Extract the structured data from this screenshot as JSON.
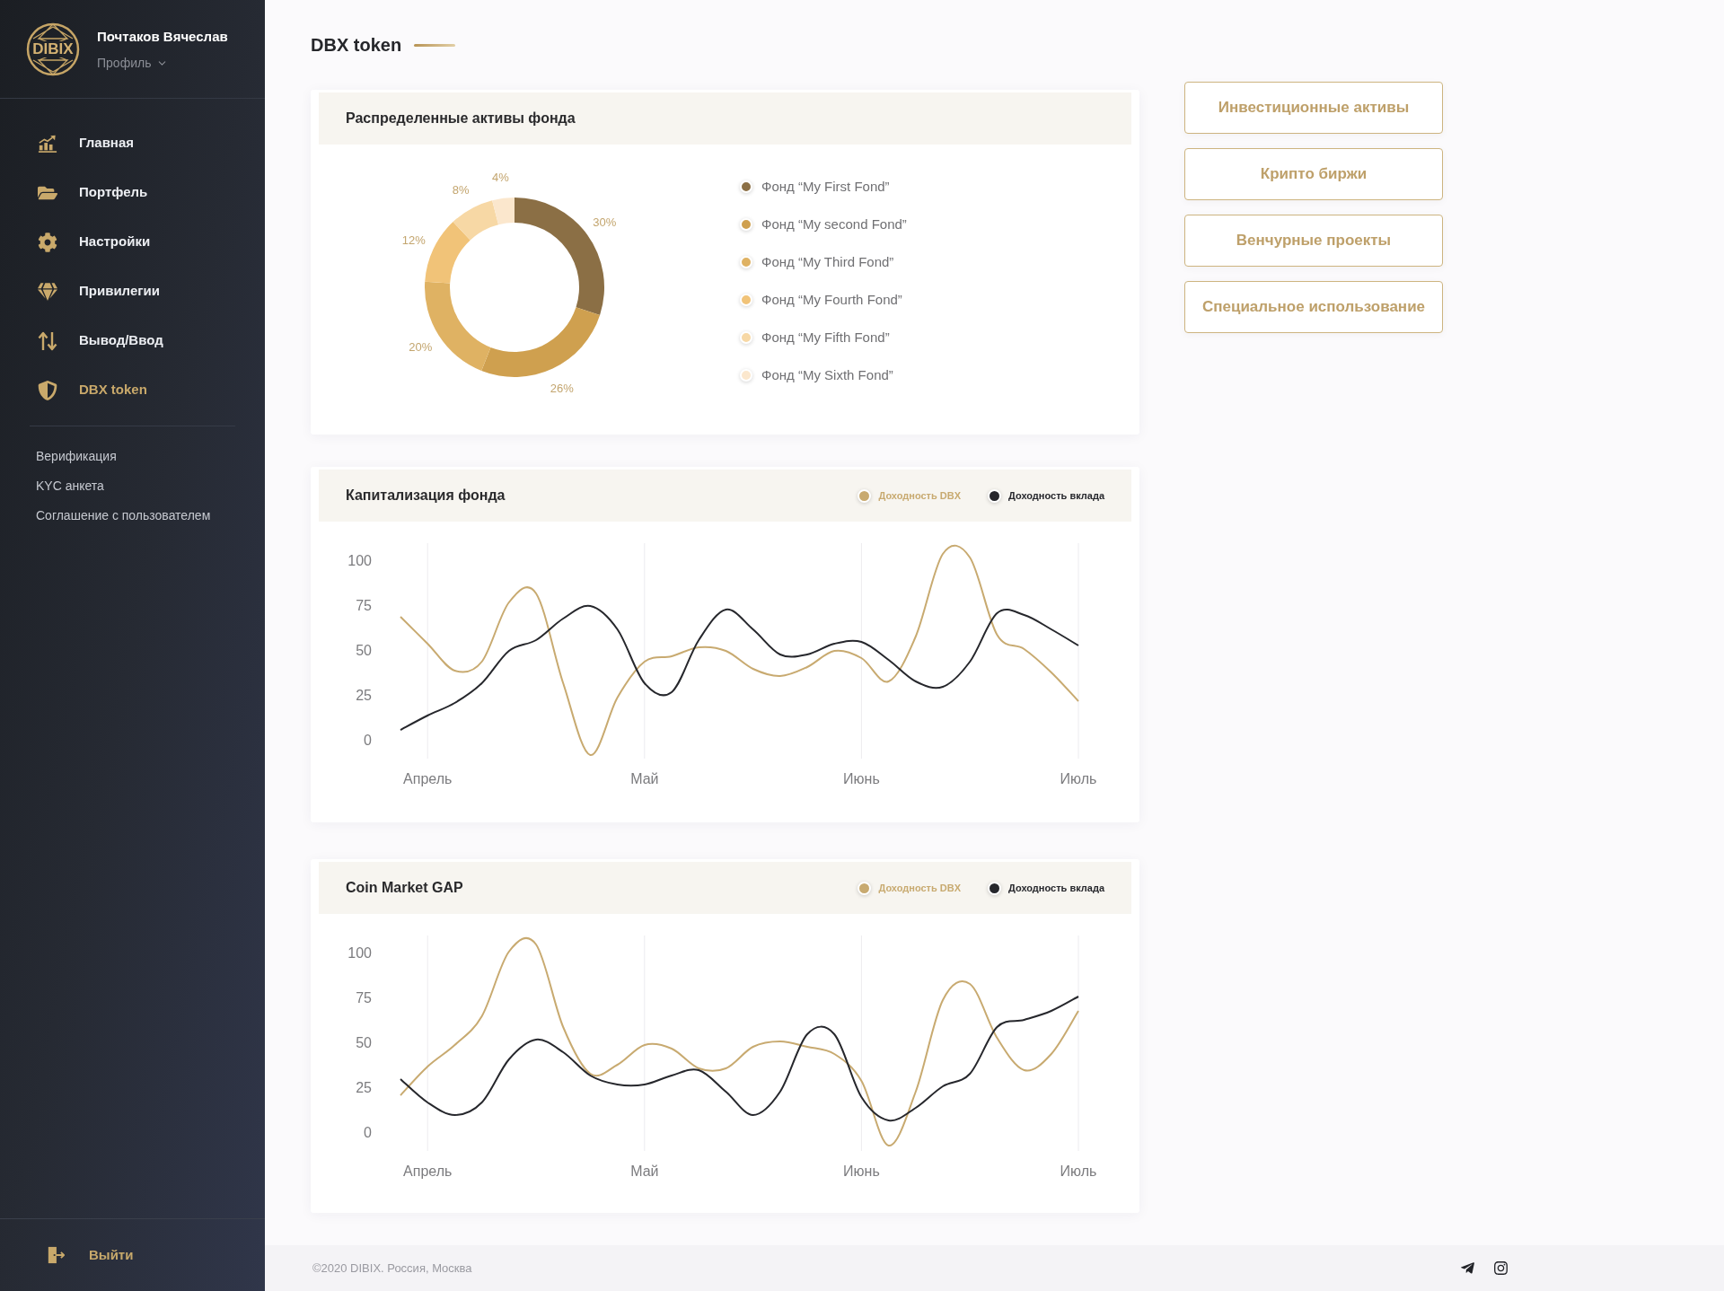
{
  "sidebar": {
    "logo": {
      "text": "DIBIX"
    },
    "user": {
      "name": "Почтаков Вячеслав",
      "menu_label": "Профиль"
    },
    "nav": [
      {
        "label": "Главная",
        "selected": false
      },
      {
        "label": "Портфель",
        "selected": false
      },
      {
        "label": "Настройки",
        "selected": false
      },
      {
        "label": "Привилегии",
        "selected": false
      },
      {
        "label": "Вывод/Ввод",
        "selected": false
      },
      {
        "label": "DBX token",
        "selected": true
      }
    ],
    "links": [
      "Верификация",
      "KYC анкета",
      "Соглашение с пользователем"
    ],
    "logout": "Выйти"
  },
  "page_title": "DBX token",
  "allocation_card": {
    "title": "Распределенные активы фонда",
    "chart_data": {
      "type": "donut",
      "values": [
        30,
        26,
        20,
        12,
        8,
        4
      ],
      "value_labels": [
        "30%",
        "26%",
        "20%",
        "12%",
        "8%",
        "4%"
      ]
    },
    "legend": [
      {
        "label": "Фонд “My First Fond”",
        "color": "#8b6f45"
      },
      {
        "label": "Фонд “My second Fond”",
        "color": "#cfa04f"
      },
      {
        "label": "Фонд “My Third Fond”",
        "color": "#dfb263"
      },
      {
        "label": "Фонд “My Fourth Fond”",
        "color": "#f1c378"
      },
      {
        "label": "Фонд “My Fifth Fond”",
        "color": "#f7d8a5"
      },
      {
        "label": "Фонд “My Sixth Fond”",
        "color": "#fbe7cd"
      }
    ]
  },
  "category_buttons": [
    "Инвестиционные активы",
    "Крипто биржи",
    "Венчурные проекты",
    "Специальное использование"
  ],
  "capitalization_card": {
    "title": "Капитализация фонда",
    "chart_data": {
      "type": "line",
      "categories": [
        null,
        "Апрель",
        null,
        null,
        null,
        null,
        null,
        null,
        null,
        "Май",
        null,
        null,
        null,
        null,
        null,
        null,
        null,
        "Июнь",
        null,
        null,
        null,
        null,
        null,
        null,
        null,
        "Июль"
      ],
      "ylim": [
        -10,
        110
      ],
      "yticks": [
        0,
        25,
        50,
        75,
        100
      ],
      "grid": "x",
      "series": [
        {
          "name": "Доходность DBX",
          "color": "#c8aa70",
          "values": [
            69,
            54,
            39,
            44,
            77,
            82,
            32,
            -8,
            24,
            44,
            47,
            52,
            50,
            40,
            36,
            41,
            50,
            46,
            33,
            58,
            104,
            102,
            59,
            51,
            38,
            22
          ]
        },
        {
          "name": "Доходность вклада",
          "color": "#26272c",
          "values": [
            6,
            14,
            21,
            32,
            50,
            56,
            68,
            75,
            62,
            32,
            27,
            56,
            73,
            62,
            48,
            48,
            54,
            55,
            45,
            33,
            30,
            44,
            71,
            70,
            62,
            53
          ]
        }
      ]
    }
  },
  "coin_market_card": {
    "title": "Coin Market GAP",
    "chart_data": {
      "type": "line",
      "categories": [
        null,
        "Апрель",
        null,
        null,
        null,
        null,
        null,
        null,
        null,
        "Май",
        null,
        null,
        null,
        null,
        null,
        null,
        null,
        "Июнь",
        null,
        null,
        null,
        null,
        null,
        null,
        null,
        "Июль"
      ],
      "ylim": [
        -10,
        110
      ],
      "yticks": [
        0,
        25,
        50,
        75,
        100
      ],
      "grid": "x",
      "series": [
        {
          "name": "Доходность DBX",
          "color": "#c8aa70",
          "values": [
            21,
            37,
            49,
            65,
            101,
            105,
            59,
            33,
            38,
            49,
            47,
            36,
            36,
            48,
            51,
            48,
            44,
            29,
            -7,
            23,
            74,
            83,
            53,
            35,
            44,
            68
          ]
        },
        {
          "name": "Доходность вклада",
          "color": "#26272c",
          "values": [
            30,
            17,
            10,
            17,
            41,
            52,
            45,
            32,
            27,
            27,
            32,
            35,
            23,
            10,
            23,
            55,
            55,
            20,
            7,
            14,
            26,
            33,
            59,
            63,
            68,
            76
          ]
        }
      ]
    }
  },
  "footer": {
    "copyright": "©2020 DIBIX. Россия, Москва"
  }
}
